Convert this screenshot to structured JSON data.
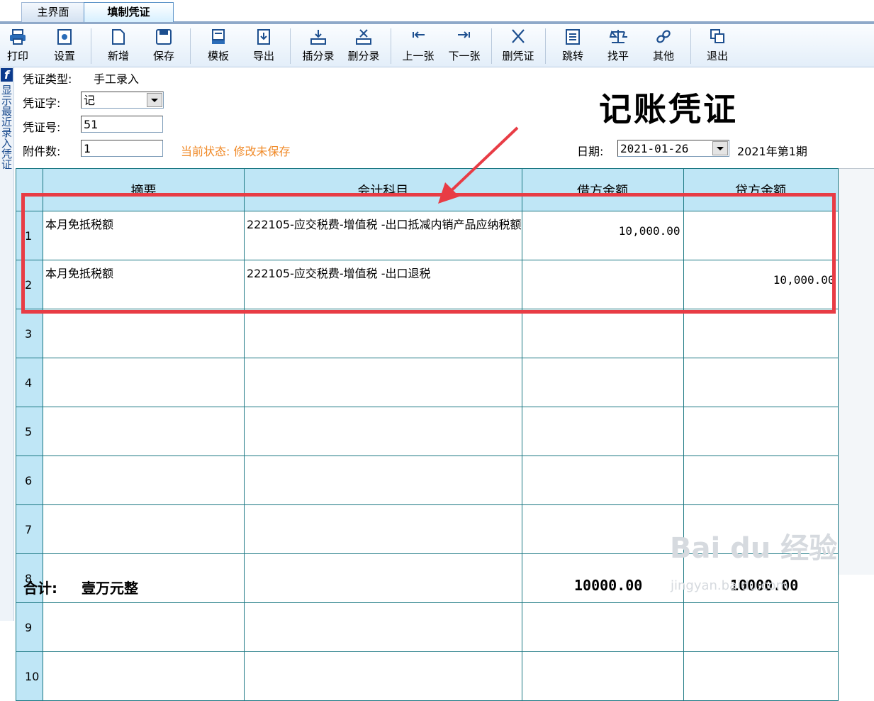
{
  "tabs": [
    {
      "label": "主界面"
    },
    {
      "label": "填制凭证"
    }
  ],
  "toolbar": {
    "buttons": [
      {
        "label": "打印",
        "icon": "printer-icon"
      },
      {
        "label": "设置",
        "icon": "gear-icon"
      },
      {
        "label": "新增",
        "icon": "new-document-icon"
      },
      {
        "label": "保存",
        "icon": "save-icon"
      },
      {
        "label": "模板",
        "icon": "template-icon"
      },
      {
        "label": "导出",
        "icon": "export-icon"
      },
      {
        "label": "插分录",
        "icon": "insert-row-icon"
      },
      {
        "label": "删分录",
        "icon": "delete-row-icon"
      },
      {
        "label": "上一张",
        "icon": "previous-icon"
      },
      {
        "label": "下一张",
        "icon": "next-icon"
      },
      {
        "label": "删凭证",
        "icon": "delete-icon"
      },
      {
        "label": "跳转",
        "icon": "jump-icon"
      },
      {
        "label": "找平",
        "icon": "balance-icon"
      },
      {
        "label": "其他",
        "icon": "link-icon"
      },
      {
        "label": "退出",
        "icon": "exit-icon"
      }
    ]
  },
  "side_strip": {
    "letter": "f",
    "text": "显示最近录入凭证"
  },
  "header": {
    "type_label": "凭证类型:",
    "type_value": "手工录入",
    "word_label": "凭证字:",
    "word_value": "记",
    "number_label": "凭证号:",
    "number_value": "51",
    "attach_label": "附件数:",
    "attach_value": "1",
    "status_label": "当前状态:",
    "status_value": "修改未保存",
    "title": "记账凭证",
    "date_label": "日期:",
    "date_value": "2021-01-26",
    "period": "2021年第1期"
  },
  "grid": {
    "columns": [
      "摘要",
      "会计科目",
      "借方金额",
      "贷方金额"
    ],
    "rows": [
      {
        "no": "1",
        "summary": "本月免抵税额",
        "account": "222105-应交税费-增值税 -出口抵减内销产品应纳税额",
        "debit": "10,000.00",
        "credit": ""
      },
      {
        "no": "2",
        "summary": "本月免抵税额",
        "account": "222105-应交税费-增值税 -出口退税",
        "debit": "",
        "credit": "10,000.00"
      },
      {
        "no": "3",
        "summary": "",
        "account": "",
        "debit": "",
        "credit": ""
      },
      {
        "no": "4",
        "summary": "",
        "account": "",
        "debit": "",
        "credit": ""
      },
      {
        "no": "5",
        "summary": "",
        "account": "",
        "debit": "",
        "credit": ""
      },
      {
        "no": "6",
        "summary": "",
        "account": "",
        "debit": "",
        "credit": ""
      },
      {
        "no": "7",
        "summary": "",
        "account": "",
        "debit": "",
        "credit": ""
      },
      {
        "no": "8",
        "summary": "",
        "account": "",
        "debit": "",
        "credit": ""
      },
      {
        "no": "9",
        "summary": "",
        "account": "",
        "debit": "",
        "credit": ""
      },
      {
        "no": "10",
        "summary": "",
        "account": "",
        "debit": "",
        "credit": ""
      }
    ]
  },
  "totals": {
    "label": "合计:",
    "words": "壹万元整",
    "debit": "10000.00",
    "credit": "10000.00"
  },
  "watermark": {
    "brand": "Bai du 经验",
    "url": "jingyan.baidu.com"
  },
  "colors": {
    "annotation": "#e83c45",
    "grid_header": "#bfe6f6",
    "status": "#f08a28"
  }
}
